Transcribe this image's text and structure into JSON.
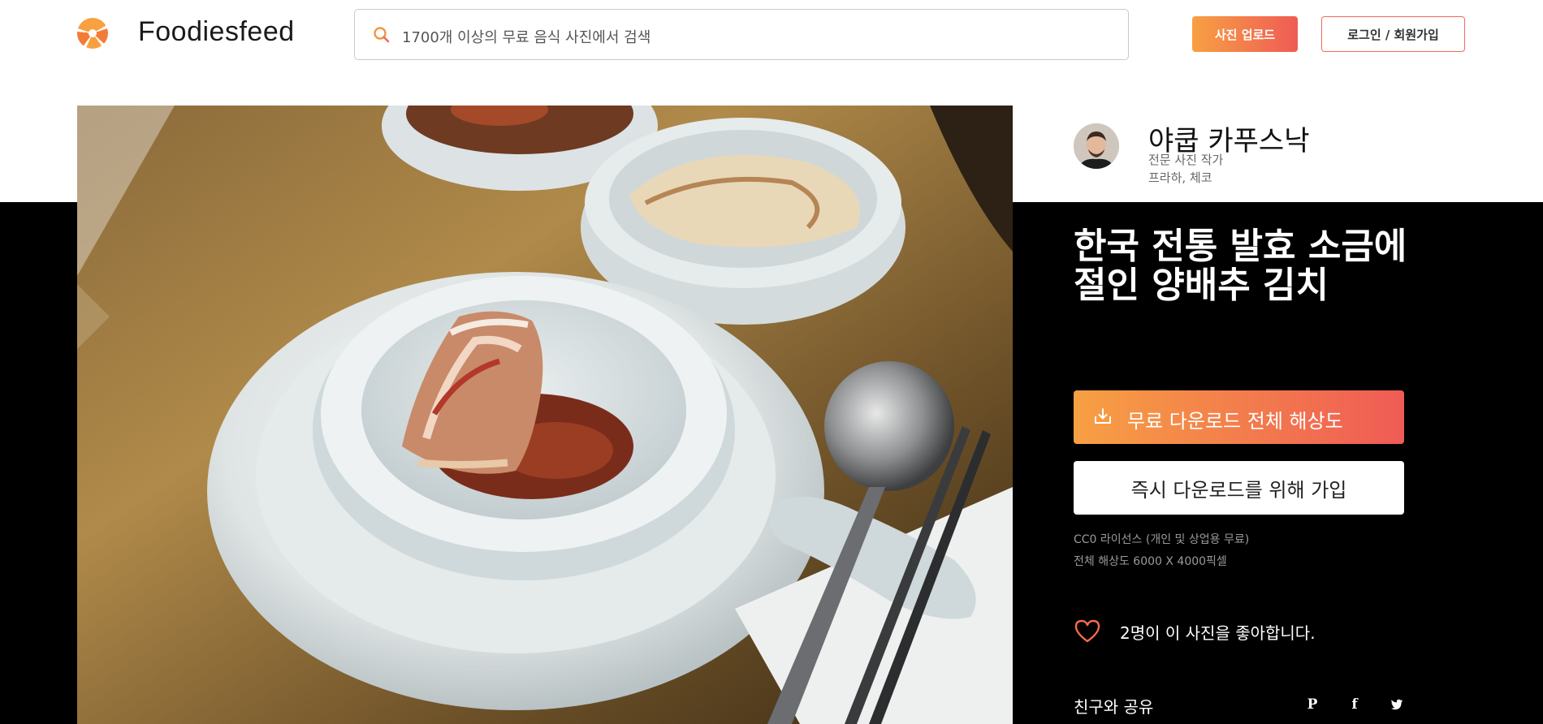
{
  "header": {
    "brand": "Foodiesfeed",
    "search_placeholder": "1700개 이상의 무료 음식 사진에서 검색",
    "upload_label": "사진 업로드",
    "login_label": "로그인 / 회원가입",
    "accent_start": "#f7a043",
    "accent_end": "#ef5b55"
  },
  "author": {
    "name": "야쿱 카푸스낙",
    "role": "전문 사진 작가",
    "location": "프라하, 체코"
  },
  "photo": {
    "title": "한국 전통 발효 소금에 절인 양배추 김치"
  },
  "actions": {
    "download_label": "무료 다운로드 전체 해상도",
    "join_label": "즉시 다운로드를 위해 가입",
    "license": "CC0 라이선스 (개인 및 상업용 무료)",
    "resolution": "전체 해상도 6000 X 4000픽셀",
    "likes": "2명이 이 사진을 좋아합니다."
  },
  "share": {
    "label": "친구와 공유",
    "icons": [
      "pinterest-icon",
      "facebook-icon",
      "twitter-icon"
    ]
  }
}
